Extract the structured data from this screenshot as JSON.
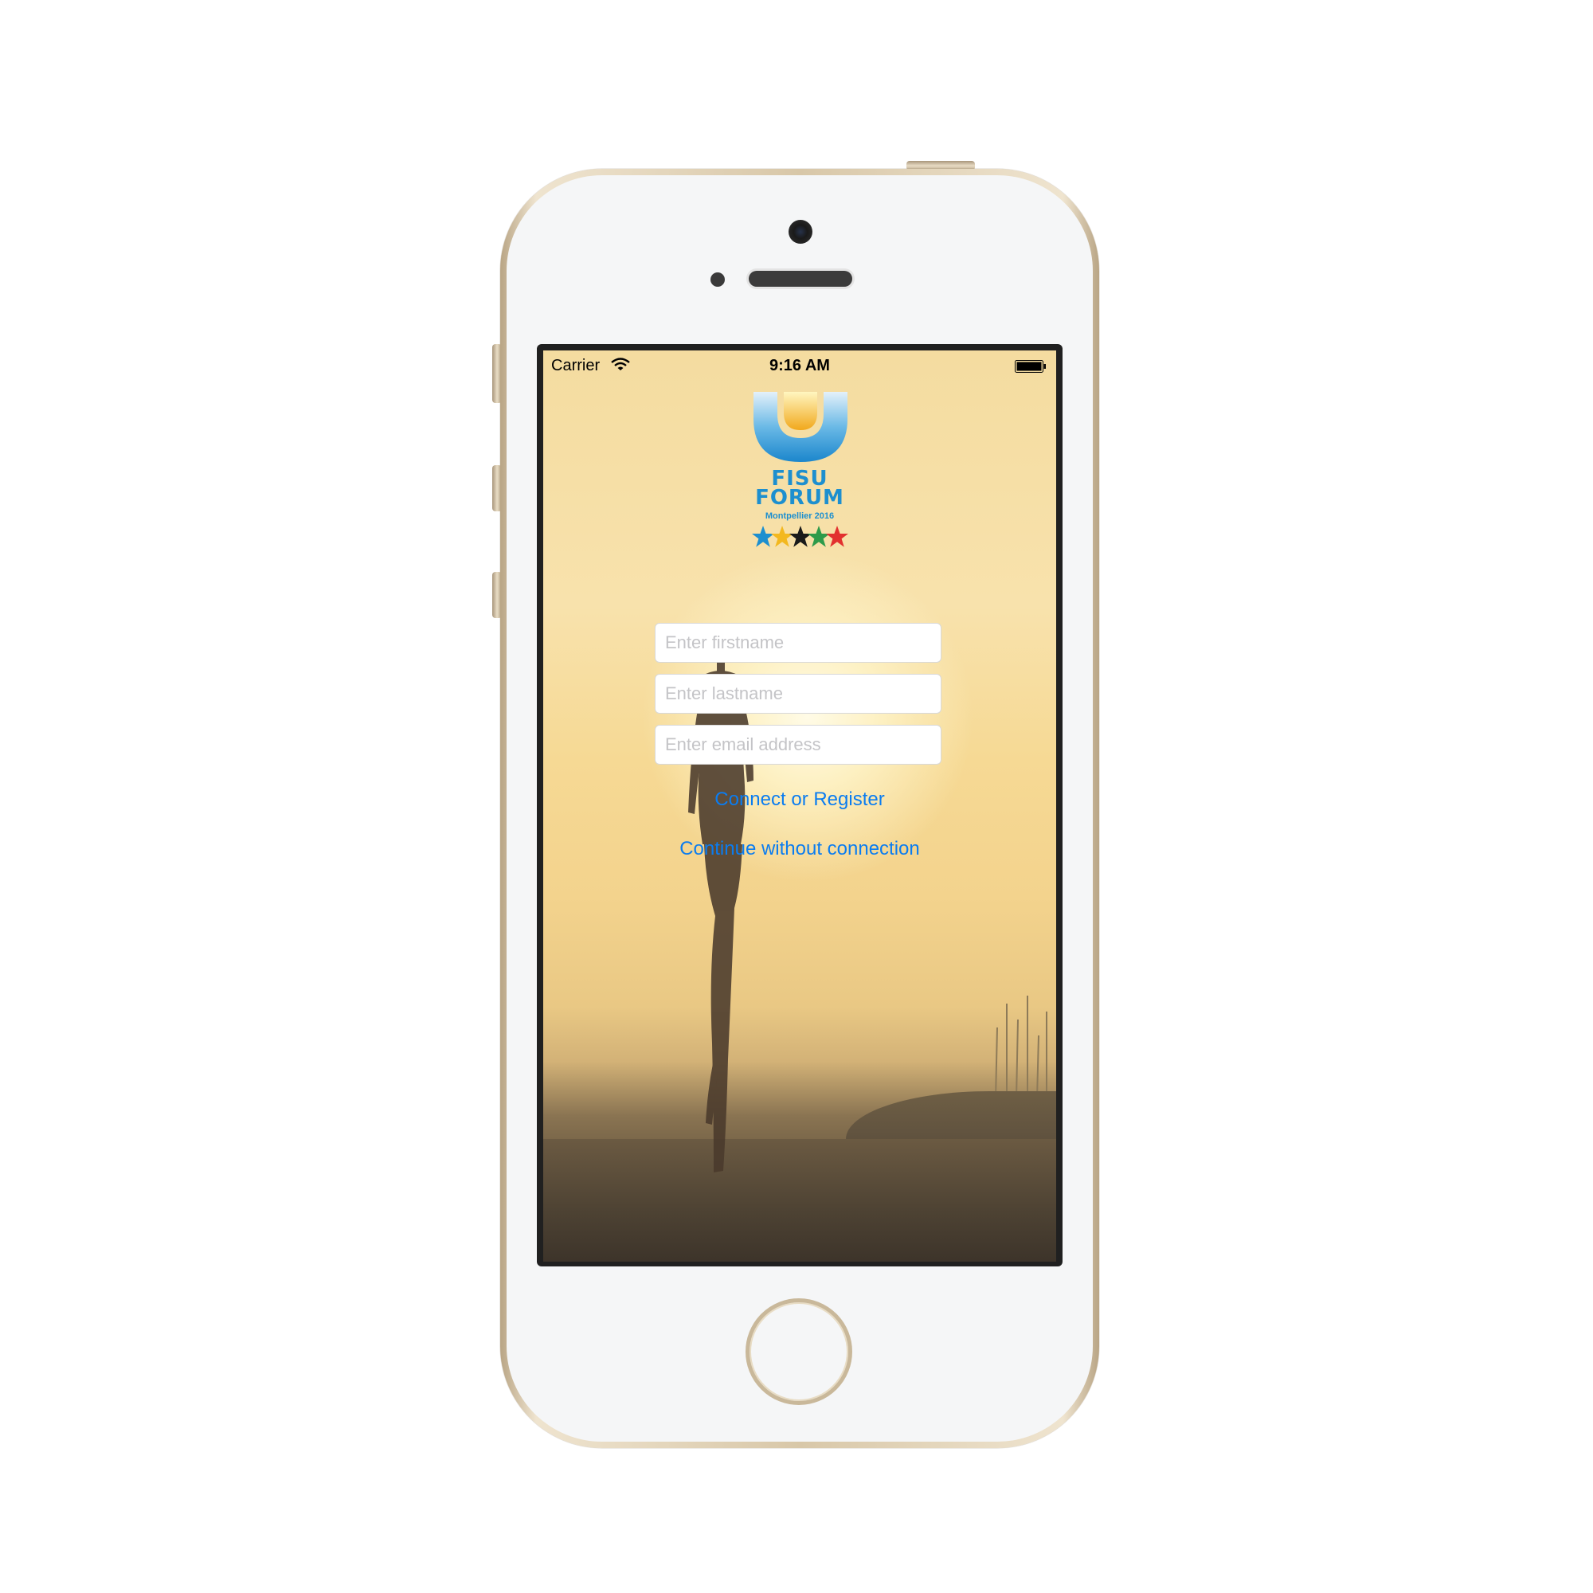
{
  "status_bar": {
    "carrier": "Carrier",
    "time": "9:16 AM"
  },
  "logo": {
    "line1": "FISU",
    "line2": "FORUM",
    "line3": "Montpellier 2016",
    "brand_color": "#1d8fcf"
  },
  "form": {
    "firstname_placeholder": "Enter firstname",
    "lastname_placeholder": "Enter lastname",
    "email_placeholder": "Enter email address",
    "connect_label": "Connect or Register",
    "continue_label": "Continue without connection",
    "link_color": "#0a7cf0"
  },
  "icons": [
    "wifi-icon",
    "battery-icon",
    "fisu-u-logo",
    "stars-logo"
  ]
}
